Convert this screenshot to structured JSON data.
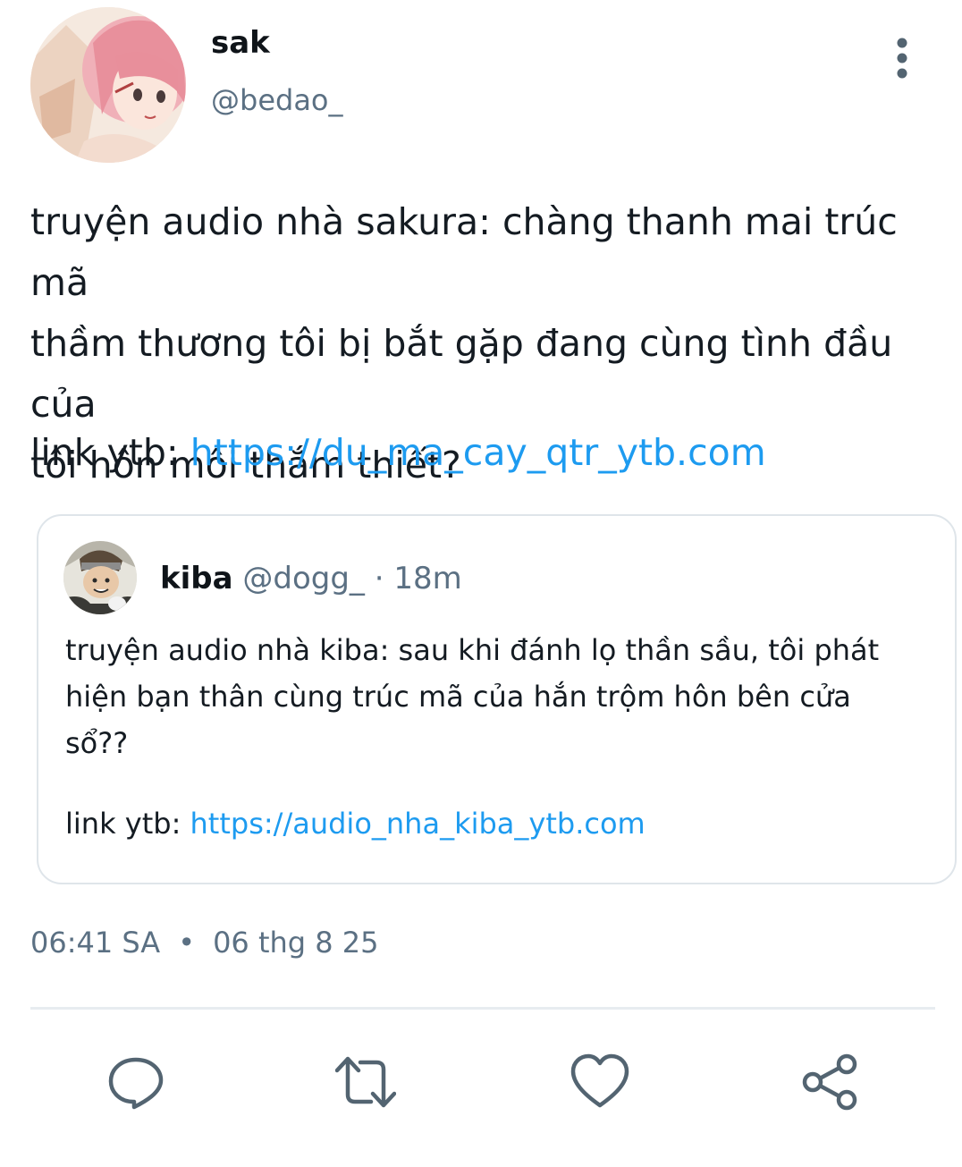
{
  "author": {
    "display_name": "sak",
    "handle": "@bedao_",
    "avatar_icon": "anime-girl-pink-hair-avatar"
  },
  "more_icon": "more-vertical-icon",
  "tweet": {
    "text": "truyện audio nhà sakura: chàng thanh mai trúc mã\nthầm thương tôi bị bắt gặp đang cùng tình đầu của\ntôi hôn môi thắm thiết?",
    "link_prefix": "link ytb: ",
    "link_text": "https://du_ma_cay_qtr_ytb.com"
  },
  "quote": {
    "name": "kiba",
    "handle": "@dogg_",
    "separator": " · ",
    "time": "18m",
    "avatar_icon": "anime-boy-avatar",
    "text": "truyện audio nhà kiba: sau khi đánh lọ thần sầu, tôi phát\nhiện bạn thân cùng trúc mã của hắn trộm hôn bên cửa\nsổ??",
    "link_prefix": "link ytb: ",
    "link_text": "https://audio_nha_kiba_ytb.com"
  },
  "meta": {
    "time": "06:41 SA",
    "dot": "•",
    "date": "06 thg 8 25"
  },
  "actions": [
    {
      "icon": "reply-icon"
    },
    {
      "icon": "retweet-icon"
    },
    {
      "icon": "like-icon"
    },
    {
      "icon": "share-icon"
    }
  ],
  "colors": {
    "link": "#1d9bf0",
    "secondary_text": "#5b7083",
    "icon": "#536471",
    "border": "#dfe5ea"
  }
}
